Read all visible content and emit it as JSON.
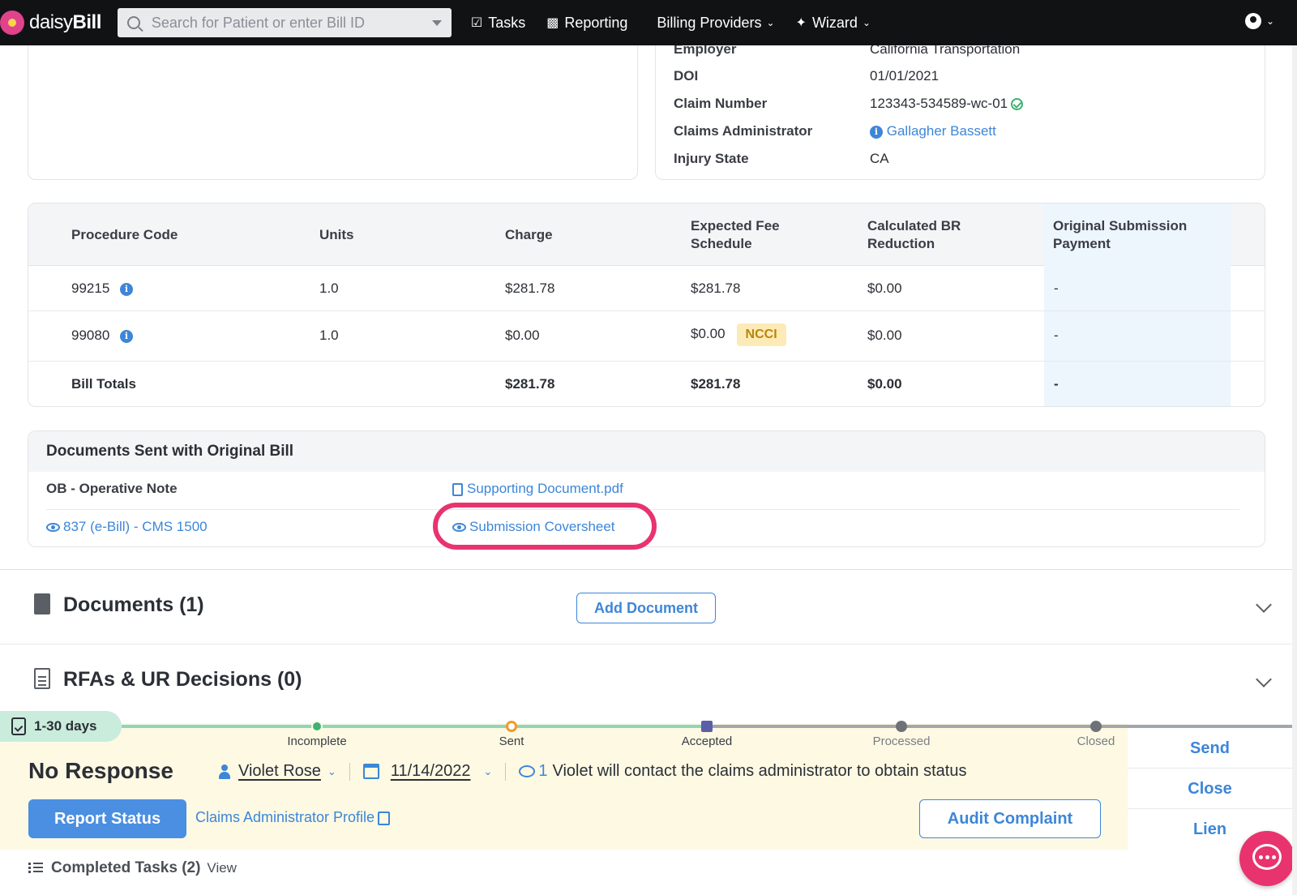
{
  "nav": {
    "logo_plain": "daisy",
    "logo_bold": "Bill",
    "search_placeholder": "Search for Patient or enter Bill ID",
    "tasks": "Tasks",
    "reporting": "Reporting",
    "billing_providers": "Billing Providers",
    "wizard": "Wizard"
  },
  "claim": {
    "employer_label": "Employer",
    "employer_value": "California Transportation",
    "doi_label": "DOI",
    "doi_value": "01/01/2021",
    "claim_number_label": "Claim Number",
    "claim_number_value": "123343-534589-wc-01",
    "claims_admin_label": "Claims Administrator",
    "claims_admin_value": "Gallagher Bassett",
    "injury_state_label": "Injury State",
    "injury_state_value": "CA"
  },
  "procedures": {
    "headers": {
      "code": "Procedure Code",
      "units": "Units",
      "charge": "Charge",
      "expected_line1": "Expected Fee",
      "expected_line2": "Schedule",
      "br_line1": "Calculated BR",
      "br_line2": "Reduction",
      "osp_line1": "Original Submission",
      "osp_line2": "Payment"
    },
    "rows": [
      {
        "code": "99215",
        "units": "1.0",
        "charge": "$281.78",
        "expected": "$281.78",
        "badge": "",
        "br": "$0.00",
        "osp": "-"
      },
      {
        "code": "99080",
        "units": "1.0",
        "charge": "$0.00",
        "expected": "$0.00",
        "badge": "NCCI",
        "br": "$0.00",
        "osp": "-"
      }
    ],
    "totals": {
      "label": "Bill Totals",
      "charge": "$281.78",
      "expected": "$281.78",
      "br": "$0.00",
      "osp": "-"
    }
  },
  "docs_sent": {
    "title": "Documents Sent with Original Bill",
    "row1_label": "OB - Operative Note",
    "row1_link": "Supporting Document.pdf",
    "row2_link_left": "837 (e-Bill) - CMS 1500",
    "row2_link_right": "Submission Coversheet"
  },
  "sections": {
    "documents_title": "Documents (1)",
    "add_document": "Add Document",
    "rfas_title": "RFAs & UR Decisions (0)"
  },
  "status": {
    "days": "1-30 days",
    "steps": [
      "Incomplete",
      "Sent",
      "Accepted",
      "Processed",
      "Closed"
    ],
    "title": "No Response",
    "assignee": "Violet Rose",
    "date": "11/14/2022",
    "comment_count": "1",
    "comment": "Violet will contact the claims administrator to obtain status",
    "report_status": "Report Status",
    "ca_profile": "Claims Administrator Profile",
    "audit_complaint": "Audit Complaint",
    "side_actions": [
      "Send",
      "Close",
      "Lien"
    ],
    "completed_label": "Completed Tasks (2)",
    "completed_view": "View"
  },
  "colors": {
    "accent": "#3d86d8",
    "highlight": "#e8336f",
    "status_bg": "#fdf9e3",
    "ncci_bg": "#fdebb7",
    "timeline_done": "#8fd6b6",
    "timeline_pending": "#a3a6ab"
  }
}
